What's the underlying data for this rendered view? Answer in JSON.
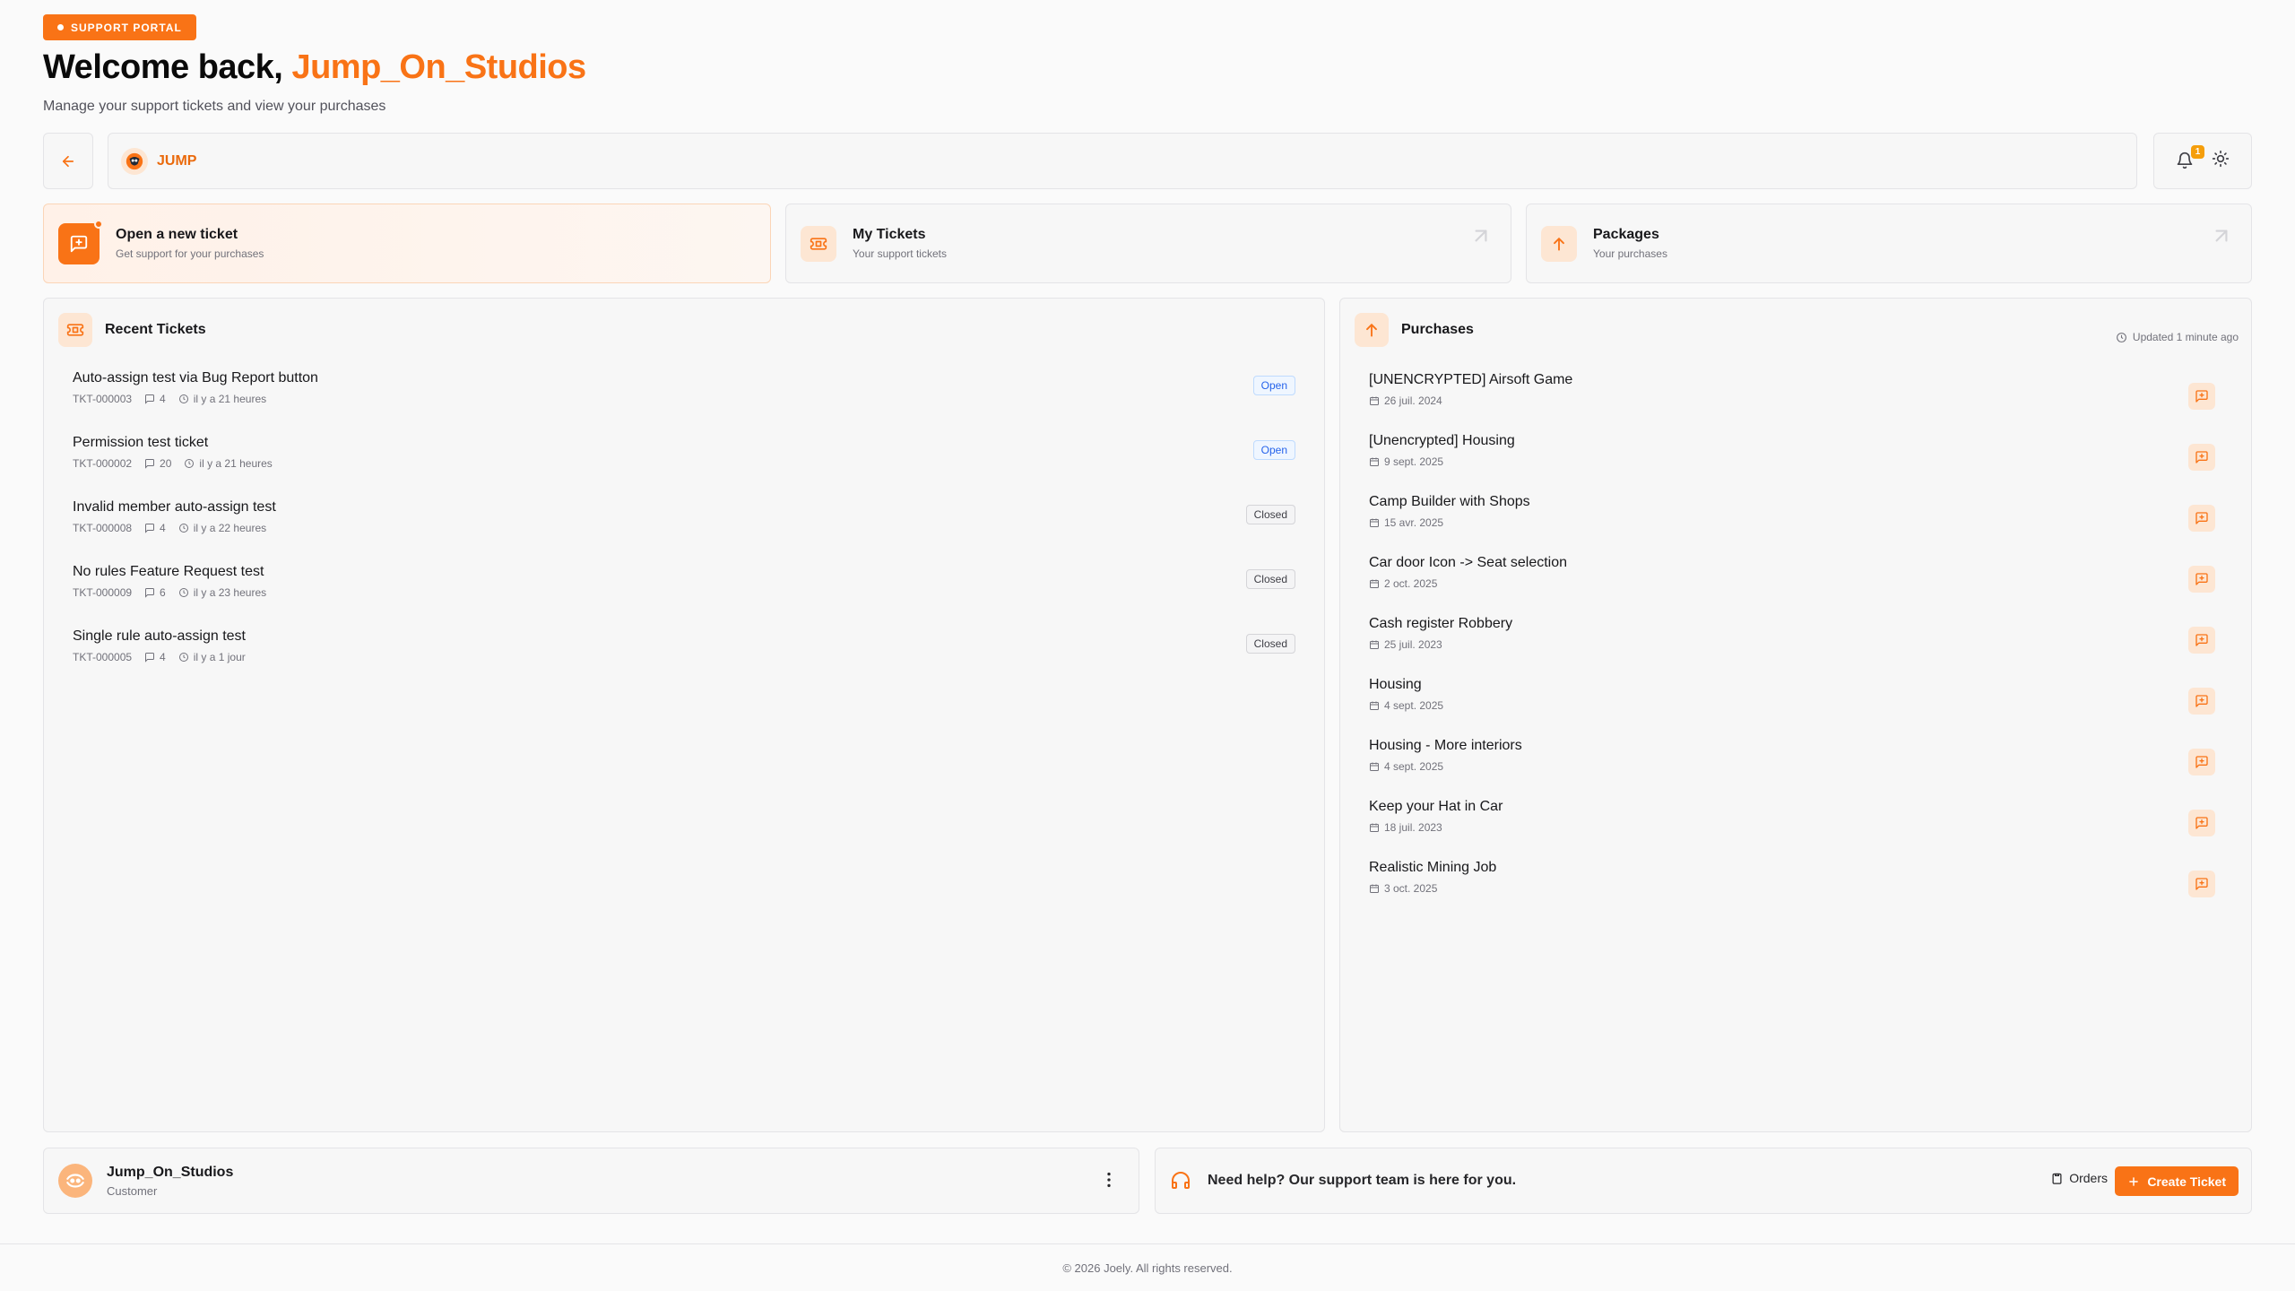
{
  "header": {
    "badge": "SUPPORT PORTAL",
    "welcome_prefix": "Welcome back,",
    "username": "Jump_On_Studios",
    "subtitle": "Manage your support tickets and view your purchases"
  },
  "topbar": {
    "brand_name": "JUMP",
    "notification_count": "1"
  },
  "quick_actions": [
    {
      "title": "Open a new ticket",
      "subtitle": "Get support for your purchases",
      "icon": "message-plus-icon"
    },
    {
      "title": "My Tickets",
      "subtitle": "Your support tickets",
      "icon": "ticket-icon"
    },
    {
      "title": "Packages",
      "subtitle": "Your purchases",
      "icon": "arrow-up-icon"
    }
  ],
  "recent_tickets": {
    "title": "Recent Tickets",
    "items": [
      {
        "title": "Auto-assign test via Bug Report button",
        "id": "TKT-000003",
        "comments": "4",
        "time": "il y a 21 heures",
        "status": "Open"
      },
      {
        "title": "Permission test ticket",
        "id": "TKT-000002",
        "comments": "20",
        "time": "il y a 21 heures",
        "status": "Open"
      },
      {
        "title": "Invalid member auto-assign test",
        "id": "TKT-000008",
        "comments": "4",
        "time": "il y a 22 heures",
        "status": "Closed"
      },
      {
        "title": "No rules Feature Request test",
        "id": "TKT-000009",
        "comments": "6",
        "time": "il y a 23 heures",
        "status": "Closed"
      },
      {
        "title": "Single rule auto-assign test",
        "id": "TKT-000005",
        "comments": "4",
        "time": "il y a 1 jour",
        "status": "Closed"
      }
    ]
  },
  "purchases": {
    "title": "Purchases",
    "updated": "Updated 1 minute ago",
    "items": [
      {
        "title": "[UNENCRYPTED] Airsoft Game",
        "date": "26 juil. 2024"
      },
      {
        "title": "[Unencrypted] Housing",
        "date": "9 sept. 2025"
      },
      {
        "title": "Camp Builder with Shops",
        "date": "15 avr. 2025"
      },
      {
        "title": "Car door Icon -> Seat selection",
        "date": "2 oct. 2025"
      },
      {
        "title": "Cash register Robbery",
        "date": "25 juil. 2023"
      },
      {
        "title": "Housing",
        "date": "4 sept. 2025"
      },
      {
        "title": "Housing - More interiors",
        "date": "4 sept. 2025"
      },
      {
        "title": "Keep your Hat in Car",
        "date": "18 juil. 2023"
      },
      {
        "title": "Realistic Mining Job",
        "date": "3 oct. 2025"
      }
    ]
  },
  "user": {
    "name": "Jump_On_Studios",
    "role": "Customer"
  },
  "help": {
    "text": "Need help? Our support team is here for you.",
    "orders_label": "Orders",
    "create_label": "Create Ticket"
  },
  "footer": {
    "text": "© 2026 Joely. All rights reserved."
  },
  "colors": {
    "accent": "#f97316",
    "open_status": "#2563eb",
    "closed_status": "#3f3f46"
  }
}
